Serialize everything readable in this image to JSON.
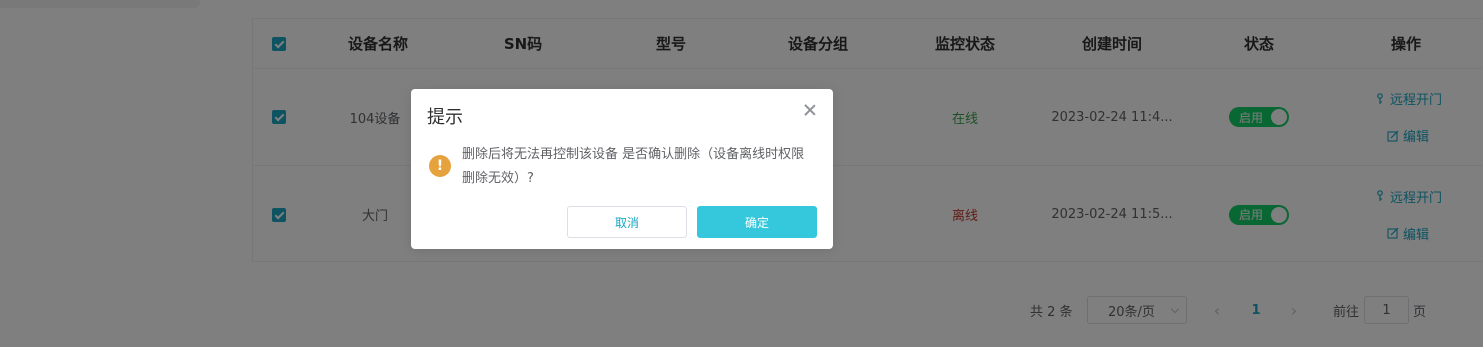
{
  "table": {
    "columns": [
      "设备名称",
      "SN码",
      "型号",
      "设备分组",
      "监控状态",
      "创建时间",
      "状态",
      "操作"
    ],
    "rows": [
      {
        "name": "104设备",
        "monitor": "在线",
        "created": "2023-02-24 11:4...",
        "status": "启用",
        "op1": "远程开门",
        "op2": "编辑"
      },
      {
        "name": "大门",
        "monitor": "离线",
        "created": "2023-02-24 11:5...",
        "status": "启用",
        "op1": "远程开门",
        "op2": "编辑"
      }
    ]
  },
  "pagination": {
    "total": "共 2 条",
    "page_size": "20条/页",
    "current_page": "1",
    "goto_label": "前往",
    "goto_value": "1",
    "page_suffix": "页"
  },
  "dialog": {
    "title": "提示",
    "message": "删除后将无法再控制该设备 是否确认删除（设备离线时权限删除无效）?",
    "cancel": "取消",
    "confirm": "确定",
    "icon": "warning-icon"
  },
  "colors": {
    "accent": "#1aa7c3",
    "online": "#3aa34a",
    "offline": "#c0392b",
    "switch_on": "#13ce66",
    "warning": "#e6a23c"
  }
}
